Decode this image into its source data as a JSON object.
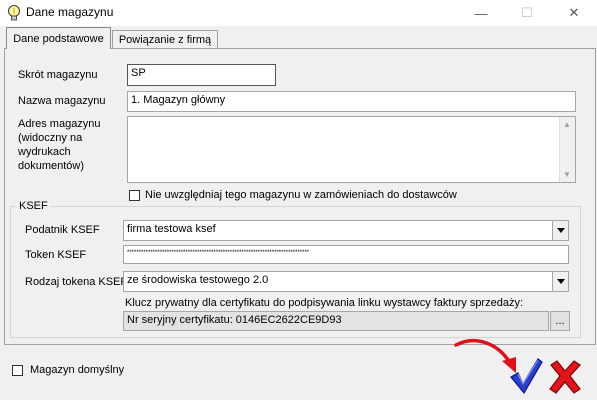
{
  "window": {
    "title": "Dane magazynu",
    "icon": "lightbulb-icon",
    "controls": {
      "minimize": "—",
      "maximize": "☐",
      "close": "✕"
    }
  },
  "tabs": [
    {
      "label": "Dane podstawowe",
      "active": true
    },
    {
      "label": "Powiązanie z firmą",
      "active": false
    }
  ],
  "form": {
    "short_label": "Skrót magazynu",
    "short_value": "SP",
    "name_label": "Nazwa magazynu",
    "name_value": "1. Magazyn główny",
    "address_label_1": "Adres magazynu",
    "address_label_2": "(widoczny na",
    "address_label_3": "wydrukach",
    "address_label_4": "dokumentów)",
    "address_value": "",
    "exclude_checkbox_label": "Nie uwzględniaj tego magazynu w zamówieniach do dostawców",
    "exclude_checked": false
  },
  "ksef": {
    "group_title": "KSEF",
    "taxpayer_label": "Podatnik KSEF",
    "taxpayer_value": "firma testowa ksef",
    "token_label": "Token KSEF",
    "token_value": "******************************************************************************",
    "token_type_label": "Rodzaj tokena KSEF",
    "token_type_value": "ze środowiska testowego 2.0",
    "private_key_label": "Klucz prywatny dla certyfikatu do podpisywania linku wystawcy faktury sprzedaży:",
    "cert_serial_value": "Nr seryjny certyfikatu: 0146EC2622CE9D93",
    "browse_label": "..."
  },
  "footer": {
    "default_checkbox_label": "Magazyn domyślny",
    "default_checked": false,
    "ok_icon": "checkmark-icon",
    "cancel_icon": "red-x-icon",
    "colors": {
      "ok": "#1a2fbf",
      "cancel": "#e4141b",
      "arrow": "#e0101a"
    }
  }
}
